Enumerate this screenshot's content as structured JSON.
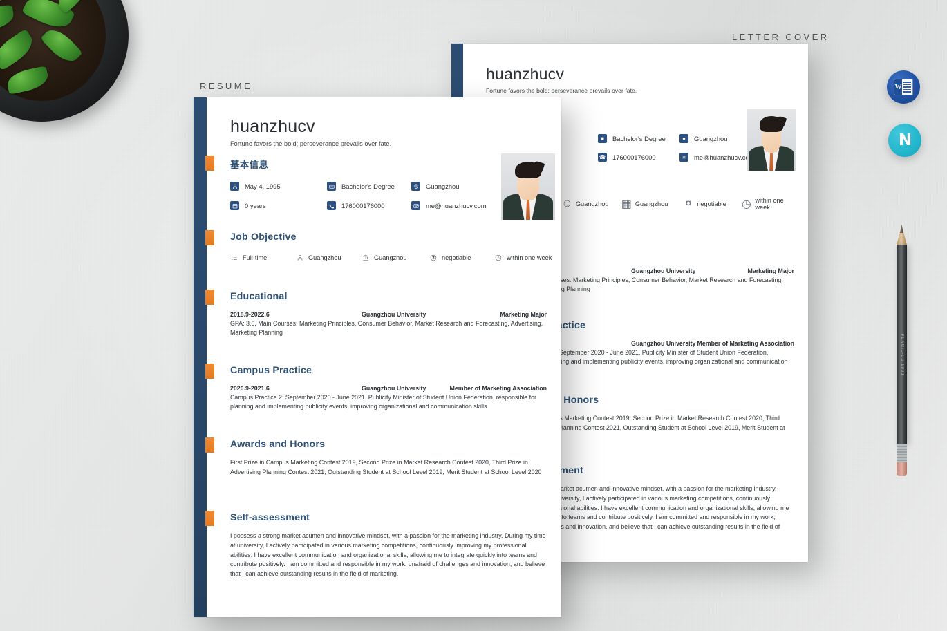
{
  "scene": {
    "background_color": "#e9eaea",
    "objects": [
      "potted-plant",
      "pencil"
    ],
    "pencil_brand": "PENCIL-US  1903"
  },
  "labels": {
    "resume": "RESUME",
    "letter_cover": "LETTER COVER"
  },
  "badges": [
    {
      "name": "word-format-badge",
      "letter": "W",
      "color": "#1f4f9e"
    },
    {
      "name": "wps-format-badge",
      "letter": "N",
      "color": "#23b6cc"
    }
  ],
  "resume": {
    "name": "huanzhucv",
    "motto": "Fortune favors the bold; perseverance prevails over fate.",
    "basic_info": {
      "title": "基本信息",
      "items": [
        {
          "icon": "user-icon",
          "text": "May 4, 1995"
        },
        {
          "icon": "diploma-icon",
          "text": "Bachelor's Degree"
        },
        {
          "icon": "location-icon",
          "text": "Guangzhou"
        },
        {
          "icon": "calendar-icon",
          "text": "0 years"
        },
        {
          "icon": "phone-icon",
          "text": "176000176000"
        },
        {
          "icon": "mail-icon",
          "text": "me@huanzhucv.com"
        }
      ]
    },
    "job_objective": {
      "title": "Job Objective",
      "items": [
        {
          "icon": "list-icon",
          "text": "Full-time"
        },
        {
          "icon": "person-icon",
          "text": "Guangzhou"
        },
        {
          "icon": "building-icon",
          "text": "Guangzhou"
        },
        {
          "icon": "money-icon",
          "text": "negotiable"
        },
        {
          "icon": "clock-icon",
          "text": "within one week"
        }
      ]
    },
    "educational": {
      "title": "Educational",
      "date": "2018.9-2022.6",
      "org": "Guangzhou University",
      "role": "Marketing Major",
      "body": "GPA: 3.6, Main Courses: Marketing Principles, Consumer Behavior, Market Research and Forecasting, Advertising, Marketing Planning"
    },
    "campus_practice": {
      "title": "Campus Practice",
      "date": "2020.9-2021.6",
      "org": "Guangzhou University",
      "role": "Member of Marketing Association",
      "body": "Campus Practice 2: September 2020 - June 2021, Publicity Minister of Student Union Federation, responsible for planning and implementing publicity events, improving organizational and communication skills"
    },
    "awards": {
      "title": "Awards and Honors",
      "body": "First Prize in Campus Marketing Contest 2019, Second Prize in Market Research Contest 2020, Third Prize in Advertising Planning Contest 2021, Outstanding Student at School Level 2019, Merit Student at School Level 2020"
    },
    "self_assessment": {
      "title": "Self-assessment",
      "body": "I possess a strong market acumen and innovative mindset, with a passion for the marketing industry. During my time at university, I actively participated in various marketing competitions, continuously improving my professional abilities. I have excellent communication and organizational skills, allowing me to integrate quickly into teams and contribute positively. I am committed and responsible in my work, unafraid of challenges and innovation, and believe that I can achieve outstanding results in the field of marketing."
    },
    "colors": {
      "sidebar": "#2b4a6e",
      "accent_tab": "#ea8126",
      "heading": "#2e5175"
    }
  }
}
